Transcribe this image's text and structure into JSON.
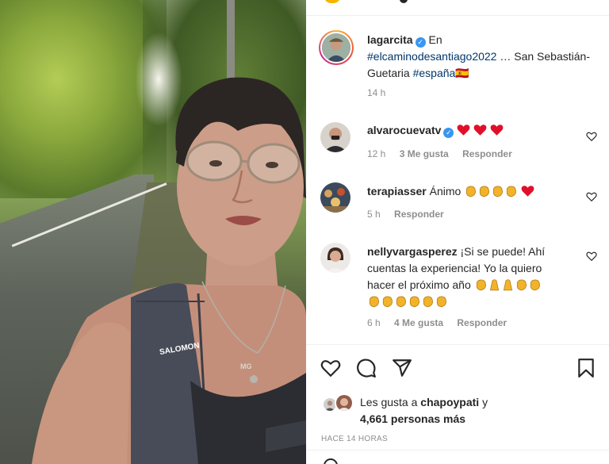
{
  "post": {
    "author": "lagarcita",
    "caption_prefix": "En",
    "caption_tag": "#elcaminodesantiago2022",
    "caption_mid": "… San Sebastián-Guetaria",
    "caption_tag2": "#españa",
    "caption_flag": "🇪🇸",
    "time": "14 h"
  },
  "comments": [
    {
      "user": "alvarocuevatv",
      "verified": true,
      "text": "",
      "time": "12 h",
      "likes": "3 Me gusta",
      "reply": "Responder"
    },
    {
      "user": "terapiasser",
      "text": "Ánimo",
      "time": "5 h",
      "reply": "Responder"
    },
    {
      "user": "nellyvargasperez",
      "text_line1": "¡Si se puede! Ahí",
      "text_line2": "cuentas la experiencia! Yo la quiero",
      "text_line3": "hacer el próximo año",
      "time": "6 h",
      "likes": "4 Me gusta",
      "reply": "Responder"
    }
  ],
  "likes": {
    "prefix": "Les gusta a",
    "user": "chapoypati",
    "suffix": "y",
    "count": "4,661 personas más"
  },
  "posted_ago": "HACE 14 HORAS",
  "photo": {
    "bag_brand": "SALOMON",
    "pendant_text": "MG"
  },
  "icons": [
    "verified-badge",
    "heart-icon",
    "comment-icon",
    "share-icon",
    "save-icon",
    "clap-emoji",
    "red-heart-emoji",
    "praying-hands-emoji"
  ],
  "colors": {
    "verified": "#3897f0",
    "heart_emoji": "#e0102a",
    "clap_emoji": "#f2b32a",
    "tag_link": "#00376b"
  }
}
